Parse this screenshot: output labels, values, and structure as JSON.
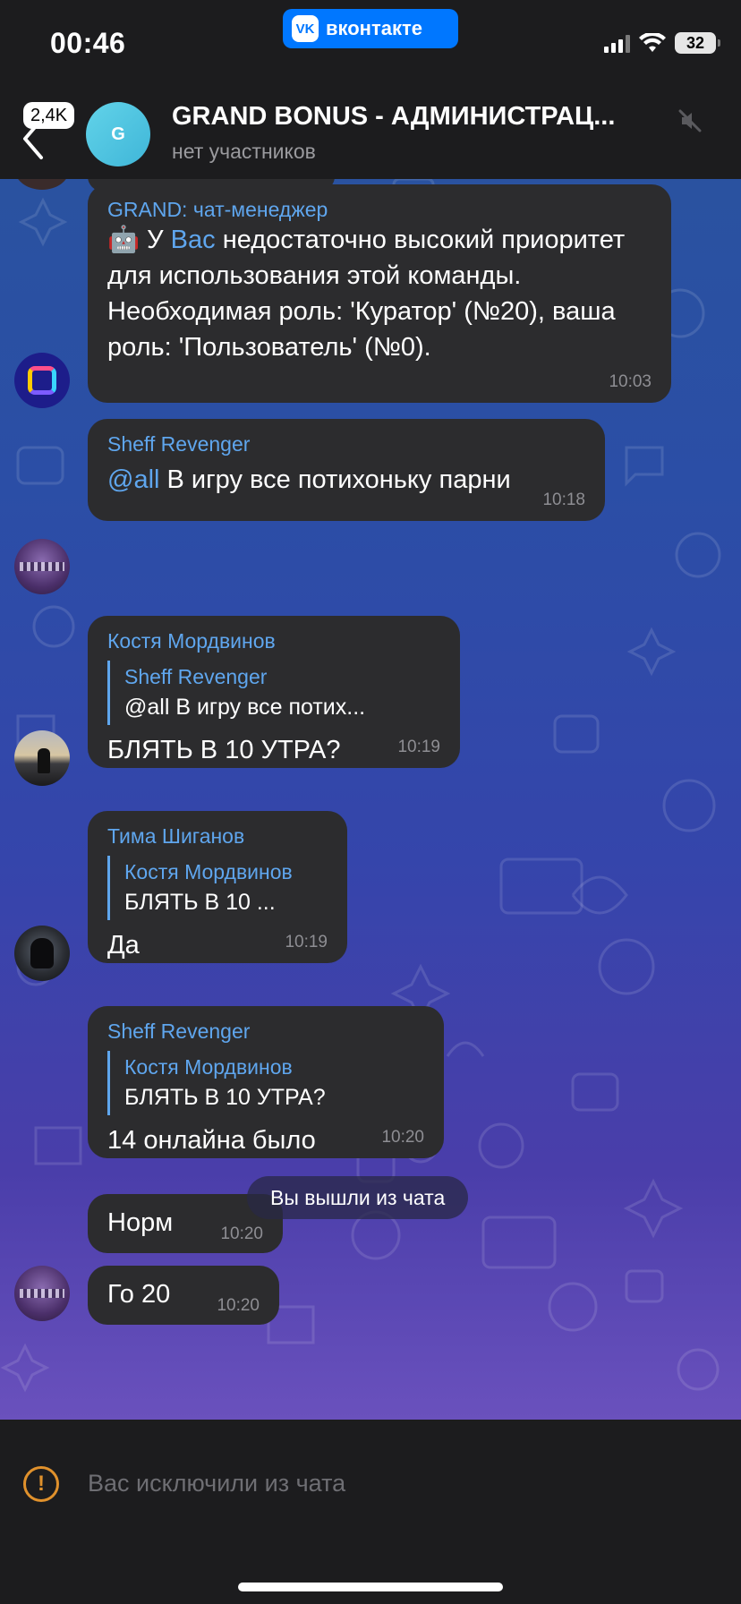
{
  "status_bar": {
    "time": "00:46",
    "app_badge": "вконтакте",
    "vk_logo": "VK",
    "battery": "32"
  },
  "header": {
    "unread_count": "2,4K",
    "avatar_letter": "G",
    "title": "GRAND BONUS - АДМИНИСТРАЦ...",
    "subtitle": "нет участников"
  },
  "messages": [
    {
      "sender": "GRAND: чат-менеджер",
      "text_before": "🤖 У ",
      "text_link": "Вас",
      "text_after": " недостаточно высокий приоритет для использования этой команды.\nНеобходимая роль: 'Куратор' (№20), ваша роль: 'Пользователь' (№0).",
      "time": "10:03"
    },
    {
      "sender": "Sheff Revenger",
      "mention": "@all",
      "text": " В игру все потихоньку парни",
      "time": "10:18"
    },
    {
      "sender": "Костя Мордвинов",
      "reply_name": "Sheff Revenger",
      "reply_text": "@all В игру все потих...",
      "text": "БЛЯТЬ В 10 УТРА?",
      "time": "10:19"
    },
    {
      "sender": "Тима Шиганов",
      "reply_name": "Костя Мордвинов",
      "reply_text": "БЛЯТЬ В 10 ...",
      "text": "Да",
      "time": "10:19"
    },
    {
      "sender": "Sheff Revenger",
      "reply_name": "Костя Мордвинов",
      "reply_text": "БЛЯТЬ В 10 УТРА?",
      "text": "14 онлайна было",
      "time": "10:20"
    },
    {
      "text": "Норм",
      "time": "10:20"
    },
    {
      "text": "Го 20",
      "time": "10:20"
    }
  ],
  "system_note": "Вы вышли из чата",
  "bottom": {
    "warning_icon": "!",
    "status_text": "Вас исключили из чата"
  }
}
